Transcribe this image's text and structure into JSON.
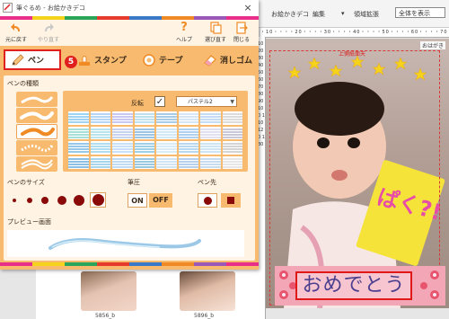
{
  "background": {
    "menu": {
      "ohagaki_tab": "お絵かきデコ",
      "edit_menu": "編集",
      "zoom_label": "領域拡張",
      "zoom_value": "全体を表示",
      "left_partial": "がき"
    },
    "ruler_top": "・10・・・・20・・・・30・・・・40・・・・50・・・・60・・・・70・・・・80・",
    "ruler_left": "10 20 30 40 50 60 70 80 90 100 110 120 130",
    "thumbnails": [
      {
        "label": "5856_b"
      },
      {
        "label": "5896_b"
      }
    ],
    "canvas": {
      "top_marker": "上側紙面天",
      "ohagaki_label": "おはがき",
      "banner_text": "おめでとう",
      "book_text": "ぱく?!"
    }
  },
  "dialog": {
    "title": "筆ぐるめ - お絵かきデコ",
    "close_symbol": "×",
    "accent_colors": [
      "#e0201e",
      "#f7ba6e",
      "#fff4e4"
    ],
    "strip_colors": [
      "#e8308a",
      "#f5d21c",
      "#2aa55a",
      "#e53a2c",
      "#3a78c8",
      "#f08a24",
      "#9a58b8",
      "#e8308a"
    ],
    "toolbar": {
      "undo": {
        "label": "元に戻す",
        "icon": "undo-icon"
      },
      "redo": {
        "label": "やり直す",
        "icon": "redo-icon"
      },
      "help": {
        "label": "ヘルプ",
        "icon": "help-icon",
        "symbol": "?"
      },
      "select_again": {
        "label": "選び直す",
        "icon": "reselect-icon"
      },
      "close": {
        "label": "閉じる",
        "icon": "exit-icon"
      }
    },
    "tabs": [
      {
        "label": "ペン",
        "icon": "pencil-icon",
        "selected": true
      },
      {
        "label": "スタンプ",
        "icon": "stamp-icon"
      },
      {
        "label": "テープ",
        "icon": "tape-icon"
      },
      {
        "label": "消しゴム",
        "icon": "eraser-icon"
      }
    ],
    "step_badge": "5",
    "pen_type_label": "ペンの種類",
    "invert_label": "反転",
    "invert_check": "✓",
    "palette_value": "パステル2",
    "palette_caret": "▼",
    "pen_size_label": "ペンのサイズ",
    "pressure_label": "筆圧",
    "pressure_on": "ON",
    "pressure_off": "OFF",
    "tip_label": "ペン先",
    "preview_label": "プレビュー画面"
  }
}
